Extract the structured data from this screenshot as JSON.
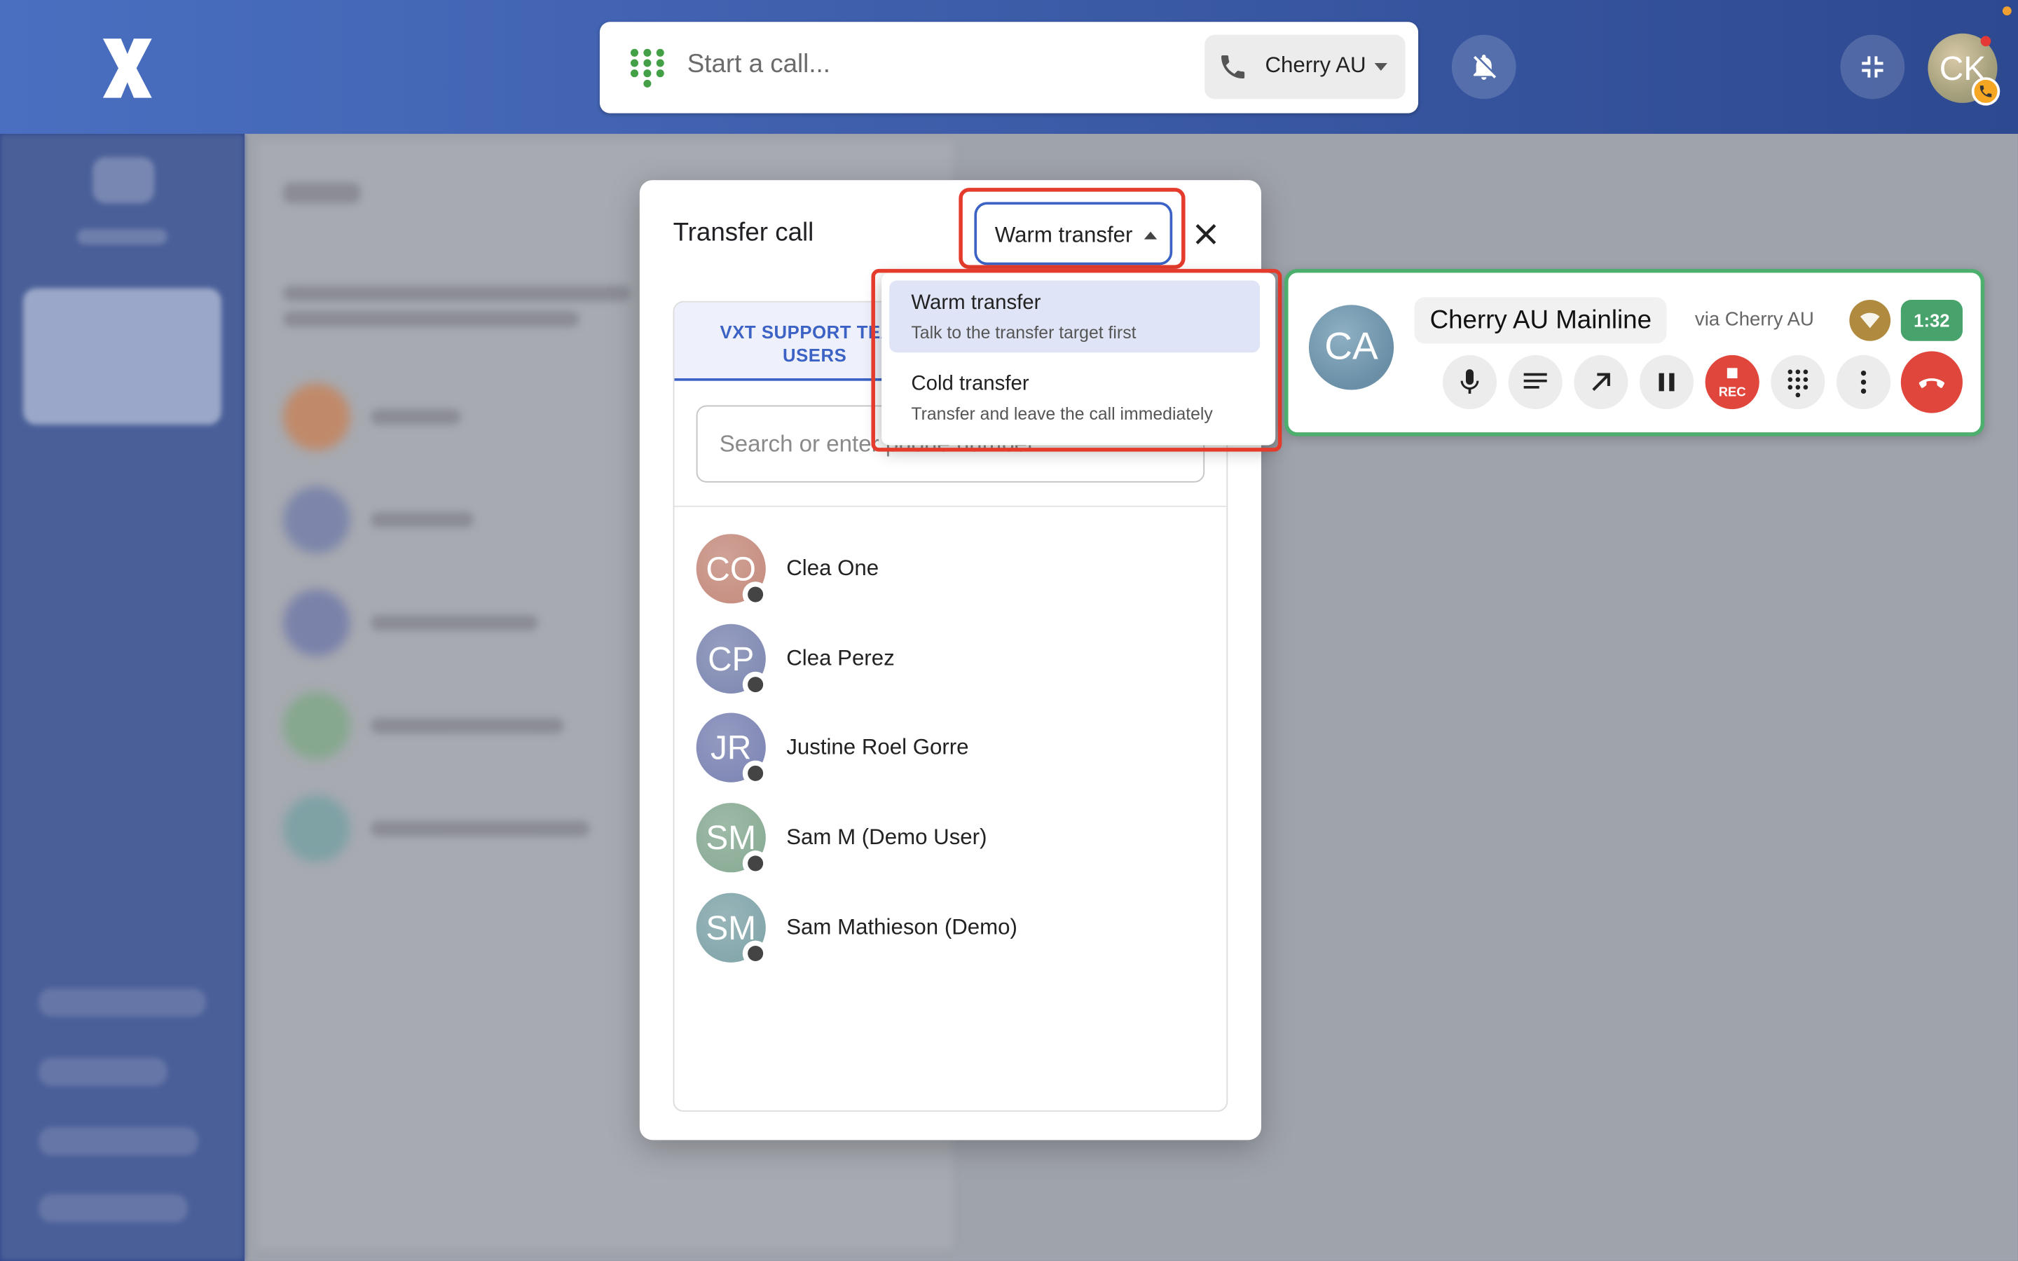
{
  "header": {
    "start_call_placeholder": "Start a call...",
    "line_name": "Cherry AU",
    "user_initials": "CK"
  },
  "modal": {
    "title": "Transfer call",
    "transfer_type": "Warm transfer",
    "tab_label": "VXT SUPPORT TEAM USERS",
    "search_placeholder": "Search or enter phone number",
    "contacts": [
      {
        "initials": "CO",
        "name": "Clea One",
        "color": "#c48a7c"
      },
      {
        "initials": "CP",
        "name": "Clea Perez",
        "color": "#7c86b0"
      },
      {
        "initials": "JR",
        "name": "Justine Roel Gorre",
        "color": "#7a82b2"
      },
      {
        "initials": "SM",
        "name": "Sam M (Demo User)",
        "color": "#86a992"
      },
      {
        "initials": "SM",
        "name": "Sam Mathieson (Demo)",
        "color": "#7ea3a8"
      }
    ]
  },
  "transfer_menu": {
    "options": [
      {
        "title": "Warm transfer",
        "subtitle": "Talk to the transfer target first",
        "selected": true
      },
      {
        "title": "Cold transfer",
        "subtitle": "Transfer and leave the call immediately",
        "selected": false
      }
    ]
  },
  "active_call": {
    "initials": "CA",
    "name": "Cherry AU Mainline",
    "via": "via Cherry AU",
    "duration": "1:32",
    "rec_label": "REC"
  },
  "colors": {
    "accent": "#3b62c4",
    "highlight": "#e53b2c",
    "call_active": "#4caf6e",
    "danger": "#e0463c"
  }
}
